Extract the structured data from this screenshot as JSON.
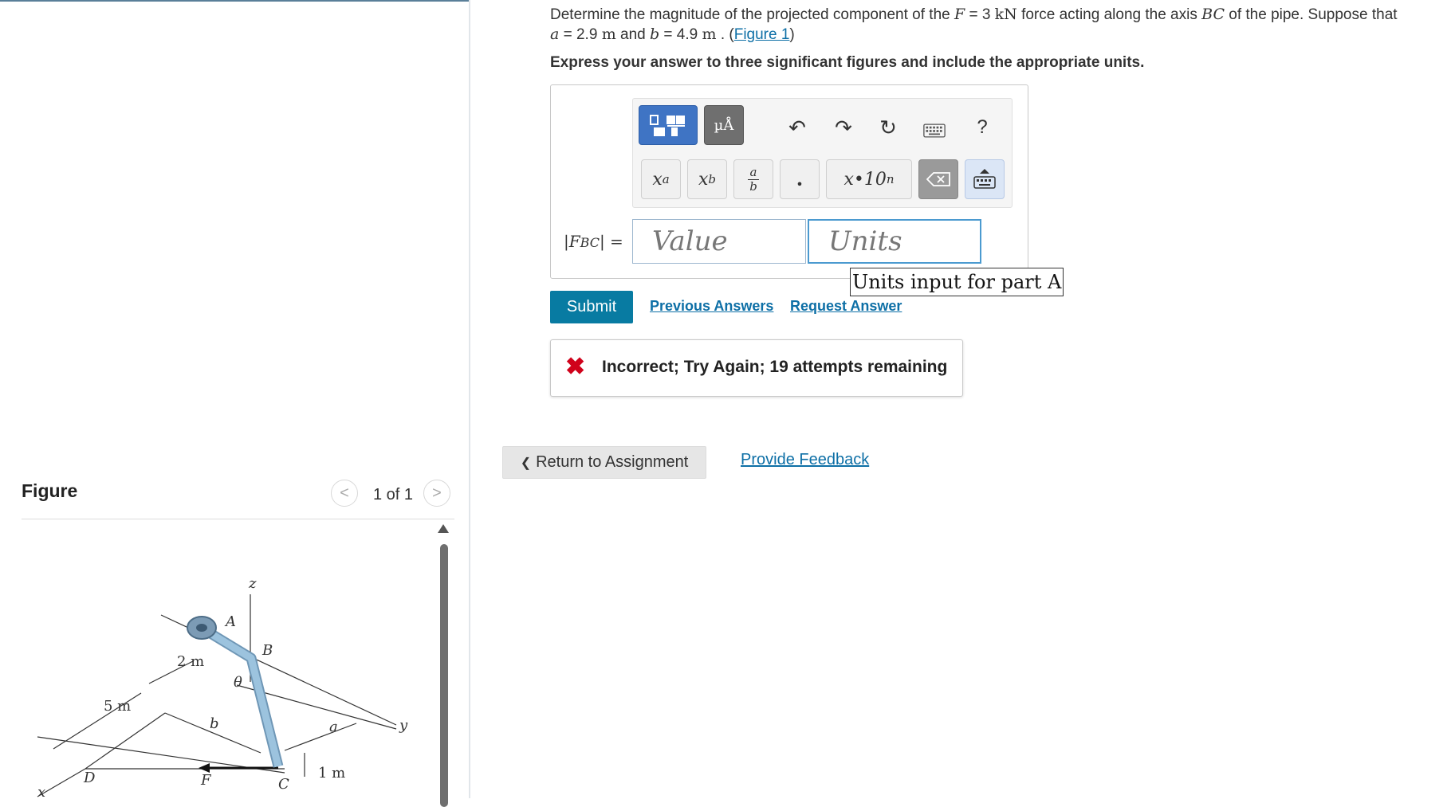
{
  "question": {
    "intro": "Determine the magnitude of the projected component of the",
    "force_var": "F",
    "force_eq": " = 3 ",
    "force_unit": "kN",
    "mid": " force acting along the axis ",
    "axis_var": "BC",
    "tail": " of the pipe. Suppose that",
    "a_var": "a",
    "a_eq": " = 2.9 ",
    "a_unit": "m",
    "and": " and ",
    "b_var": "b",
    "b_eq": " = 4.9 ",
    "b_unit": "m",
    "dot": " . (",
    "figure_link": "Figure 1",
    "close": ")"
  },
  "instruction": "Express your answer to three significant figures and include the appropriate units.",
  "toolbar": {
    "units_label": "µÅ",
    "undo": "↶",
    "redo": "↷",
    "reset": "↻",
    "help": "?",
    "keys": {
      "power_base": "x",
      "power_exp": "a",
      "sub_base": "x",
      "sub_idx": "b",
      "frac_num": "a",
      "frac_den": "b",
      "dot": "•",
      "sci": "x•10",
      "sci_exp": "n"
    }
  },
  "answer": {
    "label_open": "|",
    "label_var": "F",
    "label_sub": "BC",
    "label_close": "| =",
    "value_placeholder": "Value",
    "units_placeholder": "Units",
    "tooltip": "Units input for part A"
  },
  "actions": {
    "submit": "Submit",
    "previous_answers": "Previous Answers",
    "request_answer": "Request Answer"
  },
  "feedback": {
    "icon": "✖",
    "message": "Incorrect; Try Again; 19 attempts remaining"
  },
  "nav": {
    "return_label": "Return to Assignment",
    "return_icon": "❮",
    "provide_feedback": "Provide Feedback"
  },
  "figure_panel": {
    "title": "Figure",
    "pager": "1 of 1",
    "prev_icon": "<",
    "next_icon": ">",
    "labels": {
      "z": "z",
      "A": "A",
      "B": "B",
      "theta": "θ",
      "two_m": "2 m",
      "five_m": "5 m",
      "b": "b",
      "a": "a",
      "y": "y",
      "x": "x",
      "D": "D",
      "F": "F",
      "C": "C",
      "one_m": "1 m"
    }
  },
  "colors": {
    "accent": "#087ba2",
    "link": "#0d6fa6",
    "error": "#d0021b",
    "template_button": "#3f74c4",
    "pipe": "#9cc3de"
  }
}
